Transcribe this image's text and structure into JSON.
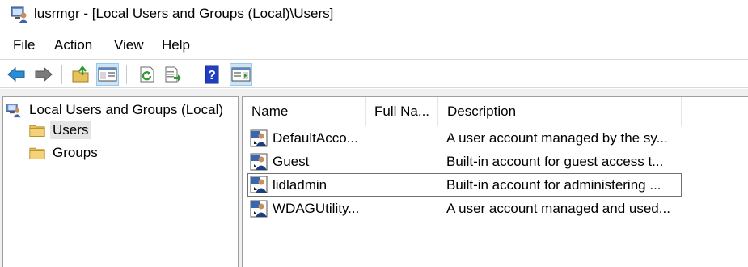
{
  "window": {
    "title": "lusrmgr - [Local Users and Groups (Local)\\Users]",
    "app_icon": "computer-users-icon"
  },
  "menu": {
    "items": [
      "File",
      "Action",
      "View",
      "Help"
    ]
  },
  "toolbar": {
    "buttons": [
      {
        "name": "back",
        "icon": "arrow-left-icon"
      },
      {
        "name": "forward",
        "icon": "arrow-right-icon"
      },
      {
        "name": "up-one-level",
        "icon": "folder-up-icon"
      },
      {
        "name": "show-hide-console-tree",
        "icon": "console-tree-icon",
        "pressed": true
      },
      {
        "name": "refresh",
        "icon": "refresh-icon"
      },
      {
        "name": "export-list",
        "icon": "export-list-icon"
      },
      {
        "name": "help",
        "icon": "help-icon"
      },
      {
        "name": "show-hide-action-pane",
        "icon": "action-pane-icon",
        "pressed": true
      }
    ]
  },
  "tree": {
    "root": {
      "label": "Local Users and Groups (Local)",
      "icon": "computer-users-icon"
    },
    "children": [
      {
        "label": "Users",
        "icon": "folder-icon",
        "selected": true
      },
      {
        "label": "Groups",
        "icon": "folder-icon",
        "selected": false
      }
    ]
  },
  "list": {
    "columns": [
      "Name",
      "Full Na...",
      "Description"
    ],
    "rows": [
      {
        "name": "DefaultAcco...",
        "full_name": "",
        "description": "A user account managed by the sy...",
        "focused": false
      },
      {
        "name": "Guest",
        "full_name": "",
        "description": "Built-in account for guest access t...",
        "focused": false
      },
      {
        "name": "lidladmin",
        "full_name": "",
        "description": "Built-in account for administering ...",
        "focused": true
      },
      {
        "name": "WDAGUtility...",
        "full_name": "",
        "description": "A user account managed and used...",
        "focused": false
      }
    ]
  },
  "colors": {
    "selection_bg": "#e5e5e5",
    "pressed_bg": "#cce4f7",
    "back_arrow": "#2a8dd4",
    "forward_arrow": "#7a7a7a",
    "folder": "#e8c15a",
    "help": "#1f3fbf"
  }
}
